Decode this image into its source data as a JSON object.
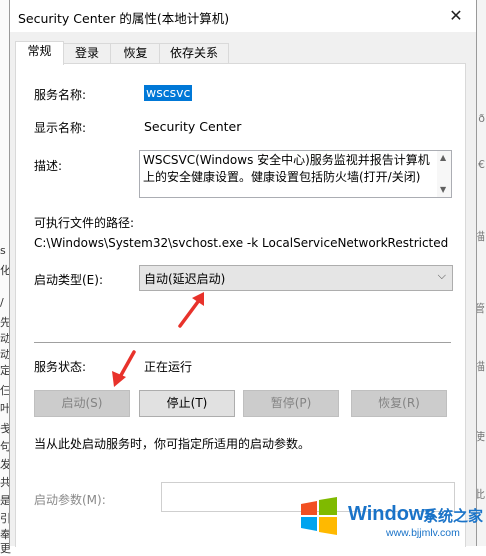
{
  "window": {
    "title": "Security Center 的属性(本地计算机)",
    "close_glyph": "✕"
  },
  "tabs": [
    {
      "label": "常规",
      "active": true
    },
    {
      "label": "登录",
      "active": false
    },
    {
      "label": "恢复",
      "active": false
    },
    {
      "label": "依存关系",
      "active": false
    }
  ],
  "general": {
    "service_name_label": "服务名称:",
    "service_name_value": "wscsvc",
    "display_name_label": "显示名称:",
    "display_name_value": "Security Center",
    "description_label": "描述:",
    "description_value": "WSCSVC(Windows 安全中心)服务监视并报告计算机上的安全健康设置。健康设置包括防火墙(打开/关闭)",
    "exe_path_label": "可执行文件的路径:",
    "exe_path_value": "C:\\Windows\\System32\\svchost.exe -k LocalServiceNetworkRestricted",
    "startup_type_label": "启动类型(E):",
    "startup_type_value": "自动(延迟启动)",
    "service_status_label": "服务状态:",
    "service_status_value": "正在运行",
    "buttons": {
      "start": "启动(S)",
      "stop": "停止(T)",
      "pause": "暂停(P)",
      "resume": "恢复(R)"
    },
    "hint_text": "当从此处启动服务时，你可指定所适用的启动参数。",
    "start_params_label": "启动参数(M):",
    "start_params_value": ""
  },
  "background": {
    "left_chars": [
      "s",
      "化",
      "/",
      "先",
      "动",
      "动",
      "定",
      "仨",
      "叶",
      "戋",
      "句",
      "发",
      "共",
      "是",
      "引",
      "奉",
      "更"
    ],
    "right_chars": [
      "ð",
      "3€",
      "描",
      "管",
      "描",
      "使",
      "此"
    ]
  },
  "watermark": {
    "brand": "Windows",
    "brand_cn": "系统之家",
    "url": "www.bjjmlv.com"
  },
  "colors": {
    "selection": "#0078d7",
    "arrow_red": "#e8322b",
    "watermark_blue": "#1a73c8"
  }
}
